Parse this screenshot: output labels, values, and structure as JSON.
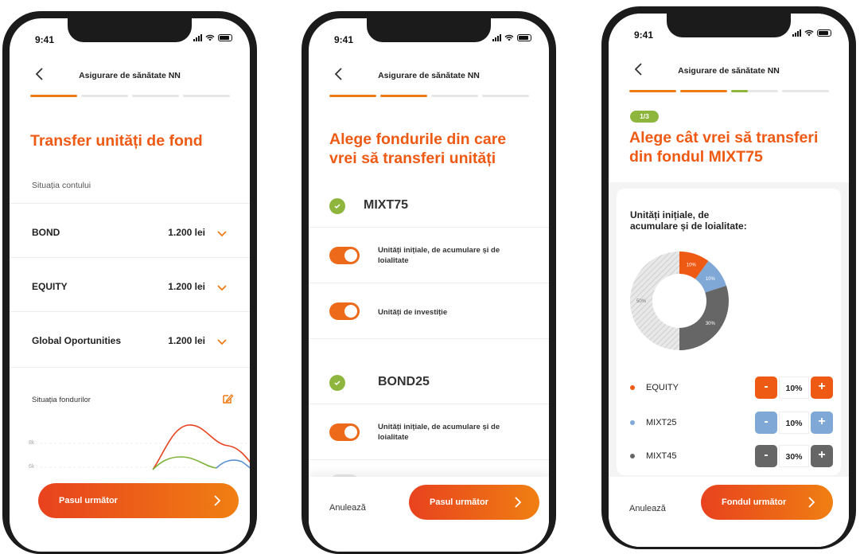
{
  "status_time": "9:41",
  "screen1": {
    "header_title": "Asigurare de sănătate NN",
    "title": "Transfer unități de fond",
    "section_label": "Situația contului",
    "accounts": [
      {
        "name": "BOND",
        "value": "1.200 lei"
      },
      {
        "name": "EQUITY",
        "value": "1.200 lei"
      },
      {
        "name": "Global Oportunities",
        "value": "1.200 lei"
      }
    ],
    "funds_label": "Situația fondurilor",
    "chart_ticks": [
      "8k",
      "6k"
    ],
    "cta_label": "Pasul următor",
    "progress_steps": 4,
    "progress_filled": 1
  },
  "screen2": {
    "header_title": "Asigurare de sănătate NN",
    "title_line1": "Alege fondurile din care",
    "title_line2": "vrei să transferi unități",
    "funds": [
      {
        "name": "MIXT75",
        "options": [
          {
            "label": "Unități inițiale, de acumulare și de loialitate",
            "on": true
          },
          {
            "label": "Unități de investiție",
            "on": true
          }
        ]
      },
      {
        "name": "BOND25",
        "options": [
          {
            "label": "Unități inițiale, de acumulare și de loialitate",
            "on": true
          }
        ]
      }
    ],
    "cancel_label": "Anulează",
    "cta_label": "Pasul următor",
    "progress_steps": 4,
    "progress_filled": 2
  },
  "screen3": {
    "header_title": "Asigurare de sănătate NN",
    "step_chip": "1/3",
    "title_line1": "Alege cât vrei să transferi",
    "title_line2": "din fondul MIXT75",
    "card_title_line1": "Unități inițiale, de",
    "card_title_line2": "acumulare și de loialitate:",
    "chart_data": {
      "type": "pie",
      "slices": [
        {
          "label": "10%",
          "value": 10,
          "color": "#ee5a14"
        },
        {
          "label": "10%",
          "value": 10,
          "color": "#7fa8d6"
        },
        {
          "label": "30%",
          "value": 30,
          "color": "#666666"
        },
        {
          "label": "50%",
          "value": 50,
          "color": "#d8d8d8"
        }
      ]
    },
    "allocations": [
      {
        "name": "EQUITY",
        "value": "10%",
        "color": "#ee5a14"
      },
      {
        "name": "MIXT25",
        "value": "10%",
        "color": "#7fa8d6"
      },
      {
        "name": "MIXT45",
        "value": "30%",
        "color": "#666666"
      }
    ],
    "minus": "-",
    "plus": "+",
    "cancel_label": "Anulează",
    "cta_label": "Fondul următor",
    "progress_steps": 4,
    "progress_filled": 2,
    "progress_partial": 0.35
  },
  "colors": {
    "accent": "#ee5a14",
    "green": "#8fb63c"
  }
}
